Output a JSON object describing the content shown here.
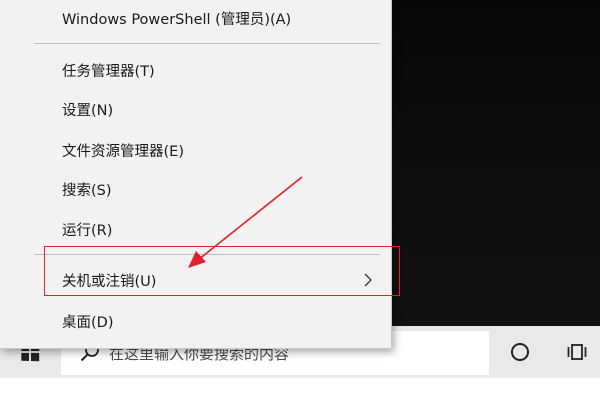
{
  "menu": {
    "items": [
      {
        "label": "Windows PowerShell (管理员)(A)"
      },
      {
        "label": "任务管理器(T)"
      },
      {
        "label": "设置(N)"
      },
      {
        "label": "文件资源管理器(E)"
      },
      {
        "label": "搜索(S)"
      },
      {
        "label": "运行(R)"
      },
      {
        "label": "关机或注销(U)",
        "has_submenu": true
      },
      {
        "label": "桌面(D)"
      }
    ]
  },
  "taskbar": {
    "search_placeholder": "在这里输入你要搜索的内容"
  },
  "annotation": {
    "color": "#e0202a"
  },
  "colors": {
    "menu_background": "#f2f2f2",
    "taskbar_background": "#e9e9e9",
    "desktop_background": "#0b0b0b"
  }
}
